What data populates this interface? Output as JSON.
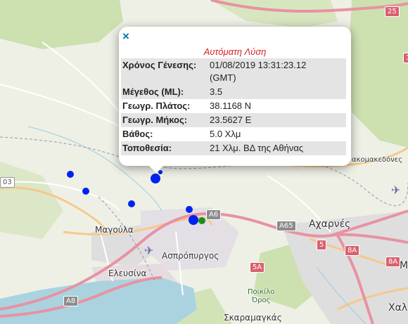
{
  "popup": {
    "close_symbol": "×",
    "title": "Αυτόματη Λύση",
    "rows": [
      {
        "label": "Χρόνος Γένεσης:",
        "value_line1": "01/08/2019 13:31:23.12",
        "value_line2": "(GMT)"
      },
      {
        "label": "Μέγεθος (ML):",
        "value": "3.5"
      },
      {
        "label": "Γεωγρ. Πλάτος:",
        "value": "38.1168 N"
      },
      {
        "label": "Γεωγρ. Μήκος:",
        "value": "23.5627 E"
      },
      {
        "label": "Βάθος:",
        "value": "5.0 Χλμ"
      },
      {
        "label": "Τοποθεσία:",
        "value": "21 Χλμ. ΒΔ της Αθήνας"
      }
    ]
  },
  "places": {
    "magoula": "Μαγούλα",
    "aspropyrgos": "Ασπρόπυργος",
    "elefsina": "Ελευσίνα",
    "acharnes": "Αχαρνές",
    "poikilo_oros_line1": "Ποικίλο",
    "poikilo_oros_line2": "Όρος",
    "akomakedones": "ακομακεδόνες",
    "skaramangas": "Σκαραμαγκάς",
    "chalandri": "Χαλ",
    "m_partial": "Μ"
  },
  "road_shields": {
    "a6": "A6",
    "a65": "A65",
    "a8": "A8",
    "e25": "25",
    "e8a": "8A",
    "n5": "5",
    "n5a": "5A",
    "n8a": "8A",
    "n03": "03",
    "r1": "1"
  },
  "colors": {
    "event_blue": "#0022ee",
    "event_green": "#1a8f1a",
    "highway": "#e892a2",
    "primary_road": "#fcd6a4",
    "sea": "#aad3df",
    "forest": "#cde0b0",
    "urban": "#dddddd",
    "popup_title": "#d62222"
  },
  "icons": {
    "airport": "airplane-icon",
    "close": "close-icon"
  }
}
